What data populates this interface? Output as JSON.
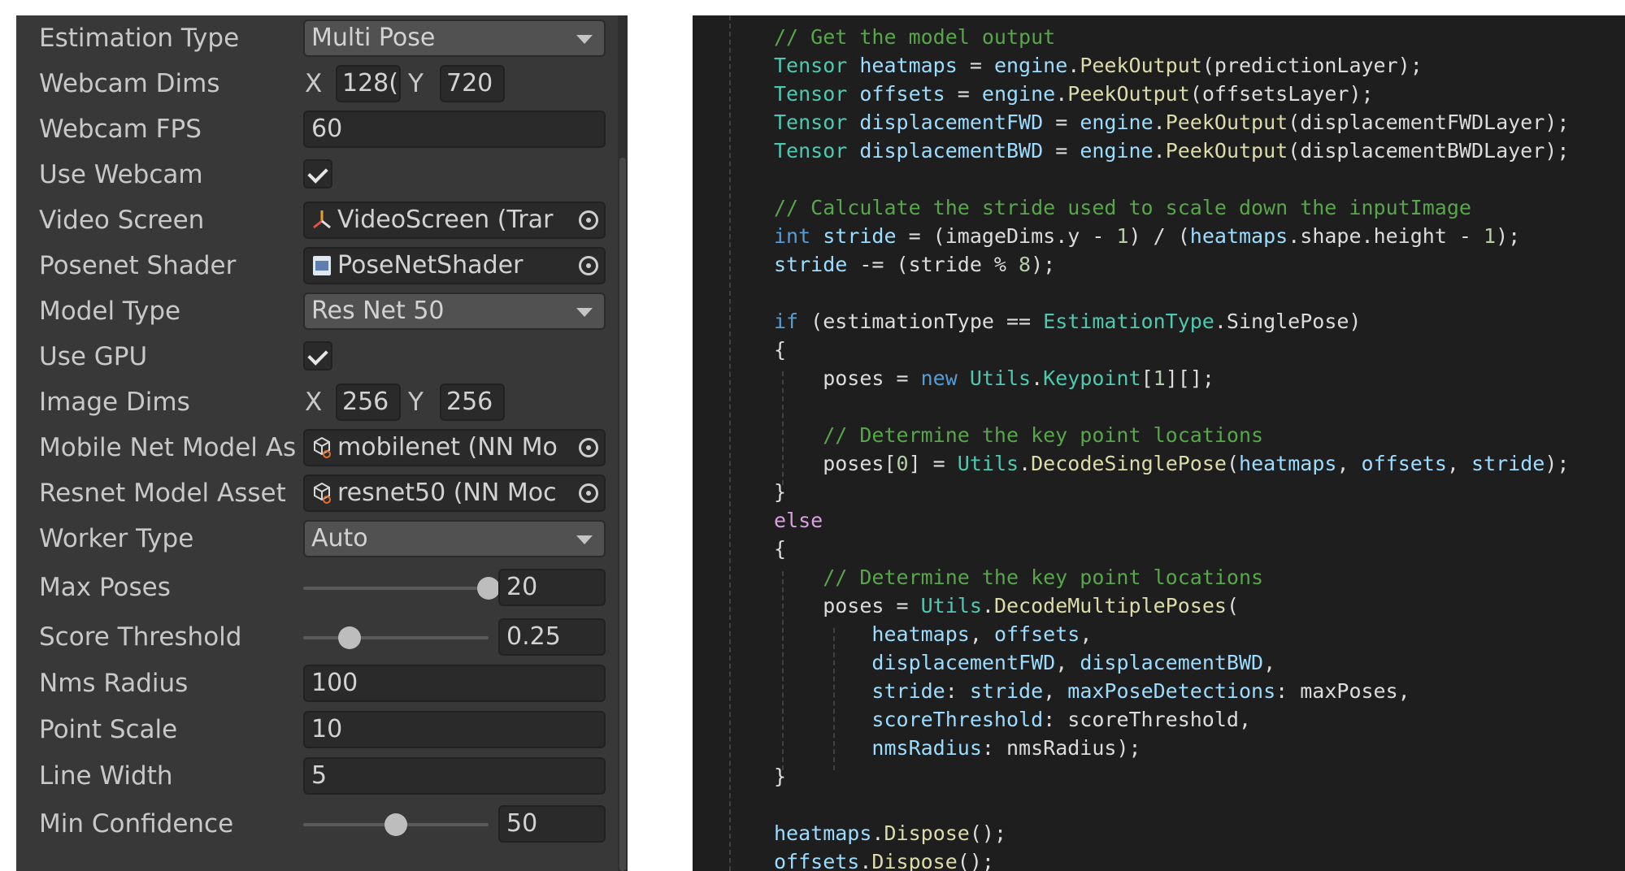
{
  "inspector": {
    "estimation_type": {
      "label": "Estimation Type",
      "value": "Multi Pose"
    },
    "webcam_dims": {
      "label": "Webcam Dims",
      "x_label": "X",
      "x": "128(",
      "y_label": "Y",
      "y": "720"
    },
    "webcam_fps": {
      "label": "Webcam FPS",
      "value": "60"
    },
    "use_webcam": {
      "label": "Use Webcam",
      "checked": true
    },
    "video_screen": {
      "label": "Video Screen",
      "value": "VideoScreen (Trar",
      "icon": "transform-icon"
    },
    "posenet_shader": {
      "label": "Posenet Shader",
      "value": "PoseNetShader",
      "icon": "compute-shader-icon"
    },
    "model_type": {
      "label": "Model Type",
      "value": "Res Net 50"
    },
    "use_gpu": {
      "label": "Use GPU",
      "checked": true
    },
    "image_dims": {
      "label": "Image Dims",
      "x_label": "X",
      "x": "256",
      "y_label": "Y",
      "y": "256"
    },
    "mobilenet_asset": {
      "label": "Mobile Net Model As",
      "value": "mobilenet (NN Mo",
      "icon": "nn-model-icon"
    },
    "resnet_asset": {
      "label": "Resnet Model Asset",
      "value": "resnet50 (NN Moc",
      "icon": "nn-model-icon"
    },
    "worker_type": {
      "label": "Worker Type",
      "value": "Auto"
    },
    "max_poses": {
      "label": "Max Poses",
      "value": "20",
      "slider_fraction": 1.0
    },
    "score_threshold": {
      "label": "Score Threshold",
      "value": "0.25",
      "slider_fraction": 0.25
    },
    "nms_radius": {
      "label": "Nms Radius",
      "value": "100"
    },
    "point_scale": {
      "label": "Point Scale",
      "value": "10"
    },
    "line_width": {
      "label": "Line Width",
      "value": "5"
    },
    "min_confidence": {
      "label": "Min Confidence",
      "value": "50",
      "slider_fraction": 0.5
    }
  },
  "code": {
    "lines": [
      [
        {
          "t": "// Get the model output",
          "c": "comment"
        }
      ],
      [
        {
          "t": "Tensor",
          "c": "type"
        },
        {
          "t": " ",
          "c": "plain"
        },
        {
          "t": "heatmaps",
          "c": "var"
        },
        {
          "t": " = ",
          "c": "plain"
        },
        {
          "t": "engine",
          "c": "var"
        },
        {
          "t": ".",
          "c": "plain"
        },
        {
          "t": "PeekOutput",
          "c": "method"
        },
        {
          "t": "(predictionLayer);",
          "c": "plain"
        }
      ],
      [
        {
          "t": "Tensor",
          "c": "type"
        },
        {
          "t": " ",
          "c": "plain"
        },
        {
          "t": "offsets",
          "c": "var"
        },
        {
          "t": " = ",
          "c": "plain"
        },
        {
          "t": "engine",
          "c": "var"
        },
        {
          "t": ".",
          "c": "plain"
        },
        {
          "t": "PeekOutput",
          "c": "method"
        },
        {
          "t": "(offsetsLayer);",
          "c": "plain"
        }
      ],
      [
        {
          "t": "Tensor",
          "c": "type"
        },
        {
          "t": " ",
          "c": "plain"
        },
        {
          "t": "displacementFWD",
          "c": "var"
        },
        {
          "t": " = ",
          "c": "plain"
        },
        {
          "t": "engine",
          "c": "var"
        },
        {
          "t": ".",
          "c": "plain"
        },
        {
          "t": "PeekOutput",
          "c": "method"
        },
        {
          "t": "(displacementFWDLayer);",
          "c": "plain"
        }
      ],
      [
        {
          "t": "Tensor",
          "c": "type"
        },
        {
          "t": " ",
          "c": "plain"
        },
        {
          "t": "displacementBWD",
          "c": "var"
        },
        {
          "t": " = ",
          "c": "plain"
        },
        {
          "t": "engine",
          "c": "var"
        },
        {
          "t": ".",
          "c": "plain"
        },
        {
          "t": "PeekOutput",
          "c": "method"
        },
        {
          "t": "(displacementBWDLayer);",
          "c": "plain"
        }
      ],
      [],
      [
        {
          "t": "// Calculate the stride used to scale down the inputImage",
          "c": "comment"
        }
      ],
      [
        {
          "t": "int",
          "c": "kw"
        },
        {
          "t": " ",
          "c": "plain"
        },
        {
          "t": "stride",
          "c": "var"
        },
        {
          "t": " = (imageDims.y - ",
          "c": "plain"
        },
        {
          "t": "1",
          "c": "num"
        },
        {
          "t": ") / (",
          "c": "plain"
        },
        {
          "t": "heatmaps",
          "c": "var"
        },
        {
          "t": ".shape.height - ",
          "c": "plain"
        },
        {
          "t": "1",
          "c": "num"
        },
        {
          "t": ");",
          "c": "plain"
        }
      ],
      [
        {
          "t": "stride",
          "c": "var"
        },
        {
          "t": " -= (stride % ",
          "c": "plain"
        },
        {
          "t": "8",
          "c": "num"
        },
        {
          "t": ");",
          "c": "plain"
        }
      ],
      [],
      [
        {
          "t": "if",
          "c": "kw"
        },
        {
          "t": " (estimationType == ",
          "c": "plain"
        },
        {
          "t": "EstimationType",
          "c": "type"
        },
        {
          "t": ".SinglePose)",
          "c": "plain"
        }
      ],
      [
        {
          "t": "{",
          "c": "plain"
        }
      ],
      [
        {
          "t": "    poses = ",
          "c": "plain"
        },
        {
          "t": "new",
          "c": "kw"
        },
        {
          "t": " ",
          "c": "plain"
        },
        {
          "t": "Utils",
          "c": "type"
        },
        {
          "t": ".",
          "c": "plain"
        },
        {
          "t": "Keypoint",
          "c": "type"
        },
        {
          "t": "[",
          "c": "plain"
        },
        {
          "t": "1",
          "c": "num"
        },
        {
          "t": "][];",
          "c": "plain"
        }
      ],
      [],
      [
        {
          "t": "    // Determine the key point locations",
          "c": "comment"
        }
      ],
      [
        {
          "t": "    poses[",
          "c": "plain"
        },
        {
          "t": "0",
          "c": "num"
        },
        {
          "t": "] = ",
          "c": "plain"
        },
        {
          "t": "Utils",
          "c": "type"
        },
        {
          "t": ".",
          "c": "plain"
        },
        {
          "t": "DecodeSinglePose",
          "c": "method"
        },
        {
          "t": "(",
          "c": "plain"
        },
        {
          "t": "heatmaps",
          "c": "var"
        },
        {
          "t": ", ",
          "c": "plain"
        },
        {
          "t": "offsets",
          "c": "var"
        },
        {
          "t": ", ",
          "c": "plain"
        },
        {
          "t": "stride",
          "c": "var"
        },
        {
          "t": ");",
          "c": "plain"
        }
      ],
      [
        {
          "t": "}",
          "c": "plain"
        }
      ],
      [
        {
          "t": "else",
          "c": "ctrl"
        }
      ],
      [
        {
          "t": "{",
          "c": "plain"
        }
      ],
      [
        {
          "t": "    // Determine the key point locations",
          "c": "comment"
        }
      ],
      [
        {
          "t": "    poses = ",
          "c": "plain"
        },
        {
          "t": "Utils",
          "c": "type"
        },
        {
          "t": ".",
          "c": "plain"
        },
        {
          "t": "DecodeMultiplePoses",
          "c": "method"
        },
        {
          "t": "(",
          "c": "plain"
        }
      ],
      [
        {
          "t": "        ",
          "c": "plain"
        },
        {
          "t": "heatmaps",
          "c": "var"
        },
        {
          "t": ", ",
          "c": "plain"
        },
        {
          "t": "offsets",
          "c": "var"
        },
        {
          "t": ",",
          "c": "plain"
        }
      ],
      [
        {
          "t": "        ",
          "c": "plain"
        },
        {
          "t": "displacementFWD",
          "c": "var"
        },
        {
          "t": ", ",
          "c": "plain"
        },
        {
          "t": "displacementBWD",
          "c": "var"
        },
        {
          "t": ",",
          "c": "plain"
        }
      ],
      [
        {
          "t": "        ",
          "c": "plain"
        },
        {
          "t": "stride",
          "c": "var"
        },
        {
          "t": ": ",
          "c": "plain"
        },
        {
          "t": "stride",
          "c": "var"
        },
        {
          "t": ", ",
          "c": "plain"
        },
        {
          "t": "maxPoseDetections",
          "c": "var"
        },
        {
          "t": ": maxPoses,",
          "c": "plain"
        }
      ],
      [
        {
          "t": "        ",
          "c": "plain"
        },
        {
          "t": "scoreThreshold",
          "c": "var"
        },
        {
          "t": ": scoreThreshold,",
          "c": "plain"
        }
      ],
      [
        {
          "t": "        ",
          "c": "plain"
        },
        {
          "t": "nmsRadius",
          "c": "var"
        },
        {
          "t": ": nmsRadius);",
          "c": "plain"
        }
      ],
      [
        {
          "t": "}",
          "c": "plain"
        }
      ],
      [],
      [
        {
          "t": "heatmaps",
          "c": "var"
        },
        {
          "t": ".",
          "c": "plain"
        },
        {
          "t": "Dispose",
          "c": "method"
        },
        {
          "t": "();",
          "c": "plain"
        }
      ],
      [
        {
          "t": "offsets",
          "c": "var"
        },
        {
          "t": ".",
          "c": "plain"
        },
        {
          "t": "Dispose",
          "c": "method"
        },
        {
          "t": "();",
          "c": "plain"
        }
      ]
    ]
  }
}
